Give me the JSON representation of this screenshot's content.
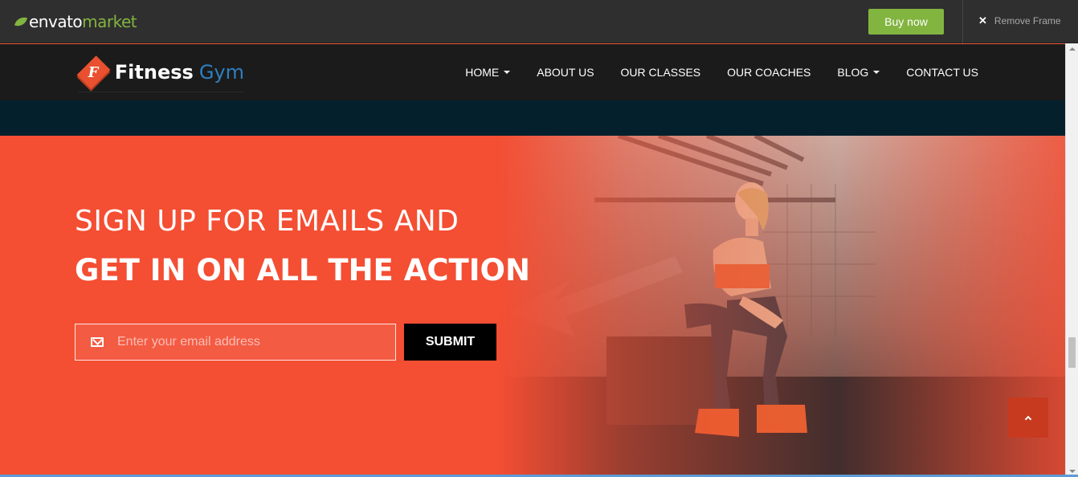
{
  "envato_bar": {
    "logo_word1": "envato",
    "logo_word2": "market",
    "buy_label": "Buy now",
    "remove_label": "Remove Frame"
  },
  "site": {
    "brand_word1": "Fitness",
    "brand_word2": "Gym",
    "brand_letter": "F",
    "menu": [
      {
        "label": "HOME",
        "dropdown": true
      },
      {
        "label": "ABOUT US",
        "dropdown": false
      },
      {
        "label": "OUR CLASSES",
        "dropdown": false
      },
      {
        "label": "OUR COACHES",
        "dropdown": false
      },
      {
        "label": "BLOG",
        "dropdown": true
      },
      {
        "label": "CONTACT US",
        "dropdown": false
      }
    ]
  },
  "hero": {
    "heading_line1": "SIGN UP FOR EMAILS AND",
    "heading_line2": "GET IN ON ALL THE ACTION",
    "email_placeholder": "Enter your email address",
    "submit_label": "SUBMIT"
  },
  "colors": {
    "accent": "#f44e33",
    "envato_green": "#82b440",
    "nav_bg": "#1b1b1b",
    "strip_bg": "#03202c"
  },
  "icons": {
    "envato_leaf": "leaf-icon",
    "close": "close-icon",
    "mail": "mail-icon",
    "scroll_top": "chevron-up-icon"
  }
}
